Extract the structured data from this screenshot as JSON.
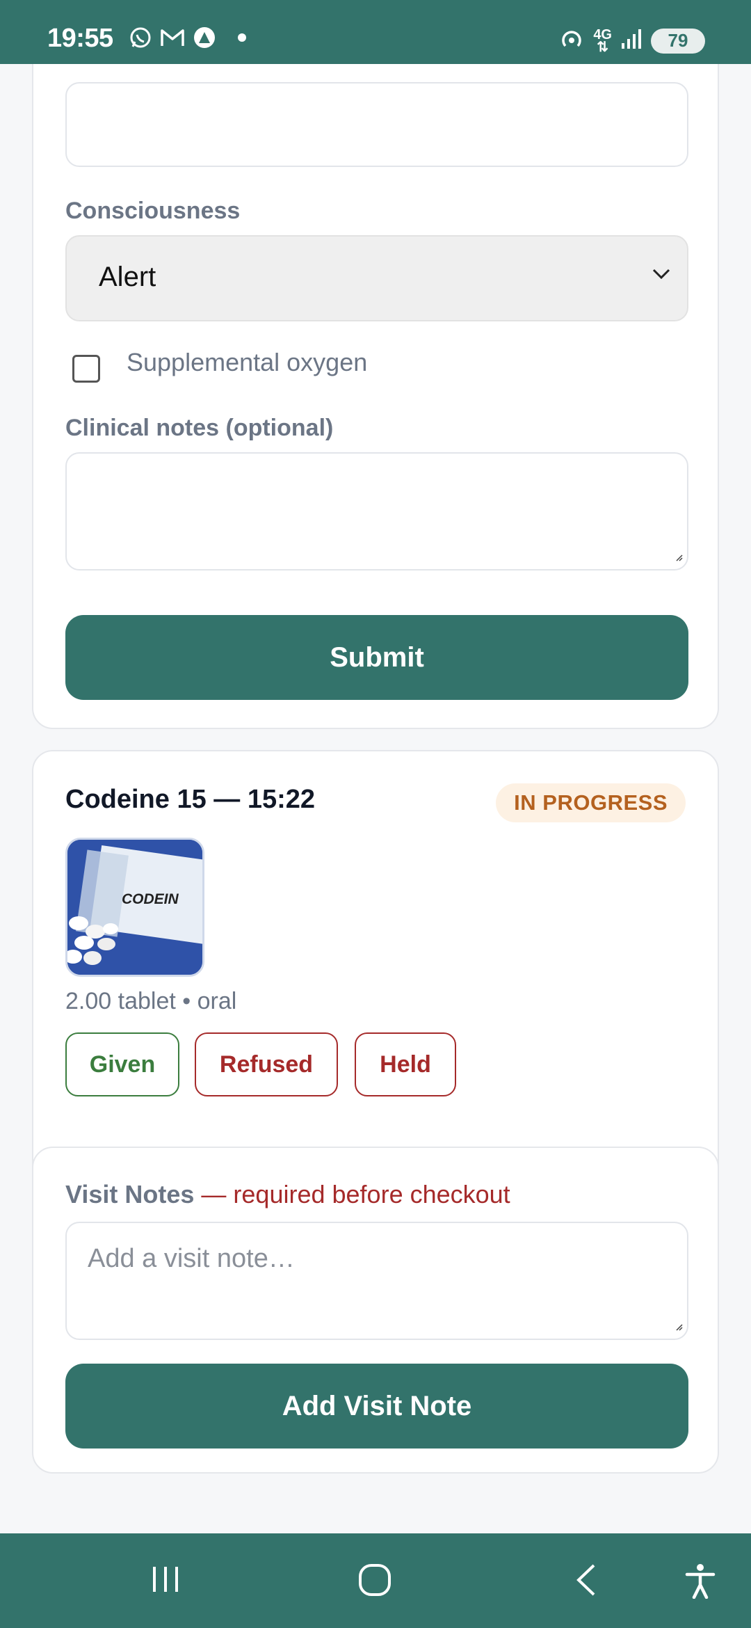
{
  "status_bar": {
    "time": "19:55",
    "network": "4G",
    "battery": "79",
    "icons": [
      "whatsapp-icon",
      "gmail-icon",
      "app-icon",
      "hotspot-icon",
      "signal-icon",
      "battery-icon"
    ]
  },
  "vitals_form": {
    "consciousness_label": "Consciousness",
    "consciousness_value": "Alert",
    "supplemental_oxygen_label": "Supplemental oxygen",
    "supplemental_oxygen_checked": false,
    "clinical_notes_label": "Clinical notes (optional)",
    "clinical_notes_value": "",
    "submit_label": "Submit"
  },
  "medication": {
    "title": "Codeine 15 — 15:22",
    "status": "IN PROGRESS",
    "image_text": "CODEIN",
    "dose": "2.00 tablet • oral",
    "actions": {
      "given": "Given",
      "refused": "Refused",
      "held": "Held"
    }
  },
  "visit_notes": {
    "title": "Visit Notes",
    "required_text": "— required before checkout",
    "placeholder": "Add a visit note…",
    "add_button": "Add Visit Note"
  },
  "colors": {
    "primary": "#33736b",
    "badge_text": "#b4611f",
    "danger": "#a52a2a",
    "success": "#3b7d3e"
  }
}
